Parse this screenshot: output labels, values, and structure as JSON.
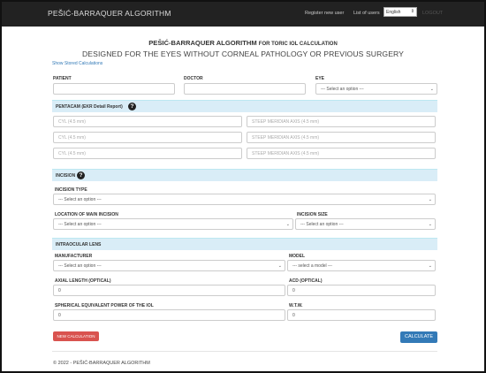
{
  "navbar": {
    "brand": "PEŠIĆ-BARRAQUER ALGORITHM",
    "register_link": "Register new user",
    "list_users_link": "List of users",
    "language_selected": "English",
    "logout": "LOGOUT"
  },
  "header": {
    "title_main": "PEŠIĆ-BARRAQUER ALGORITHM",
    "title_suffix": "FOR TORIC IOL CALCULATION",
    "subtitle": "DESIGNED FOR THE EYES WITHOUT CORNEAL PATHOLOGY OR PREVIOUS SURGERY",
    "stored_link": "Show Stored Calculations"
  },
  "patient_row": {
    "patient_label": "PATIENT",
    "patient_value": "",
    "doctor_label": "DOCTOR",
    "doctor_value": "",
    "eye_label": "EYE",
    "eye_selected": "--- Select an option ---"
  },
  "pentacam": {
    "heading": "PENTACAM (EKR Detail Report)",
    "cyl_placeholder": "CYL (4.5 mm)",
    "axis_placeholder": "STEEP MERIDIAN AXIS (4.5 mm)"
  },
  "incision": {
    "heading": "INCISION",
    "type_label": "INCISION TYPE",
    "type_selected": "--- Select an option ---",
    "location_label": "LOCATION OF MAIN INCISION",
    "location_selected": "--- Select an option ---",
    "size_label": "INCISION SIZE",
    "size_selected": "--- Select an option ---"
  },
  "iol": {
    "heading": "INTRAOCULAR LENS",
    "manufacturer_label": "MANUFACTURER",
    "manufacturer_selected": "--- Select an option ---",
    "model_label": "MODEL",
    "model_selected": "--- select a model ---",
    "axial_label": "AXIAL LENGTH (OPTICAL)",
    "axial_value": "0",
    "acd_label": "ACD (OPTICAL)",
    "acd_value": "0",
    "se_label": "SPHERICAL EQUIVALENT POWER OF THE IOL",
    "se_value": "0",
    "wtw_label": "W.T.W.",
    "wtw_value": "0"
  },
  "actions": {
    "new_calc": "NEW CALCULATION",
    "calculate": "CALCULATE"
  },
  "footer": {
    "text": "© 2022 - PEŠIĆ-BARRAQUER ALGORITHM"
  },
  "icons": {
    "help": "question-circle-icon",
    "chevron": "chevron-down-icon"
  },
  "colors": {
    "navbar": "#222222",
    "section_bg": "#d9edf7",
    "primary": "#337ab7",
    "danger": "#d9534f"
  }
}
